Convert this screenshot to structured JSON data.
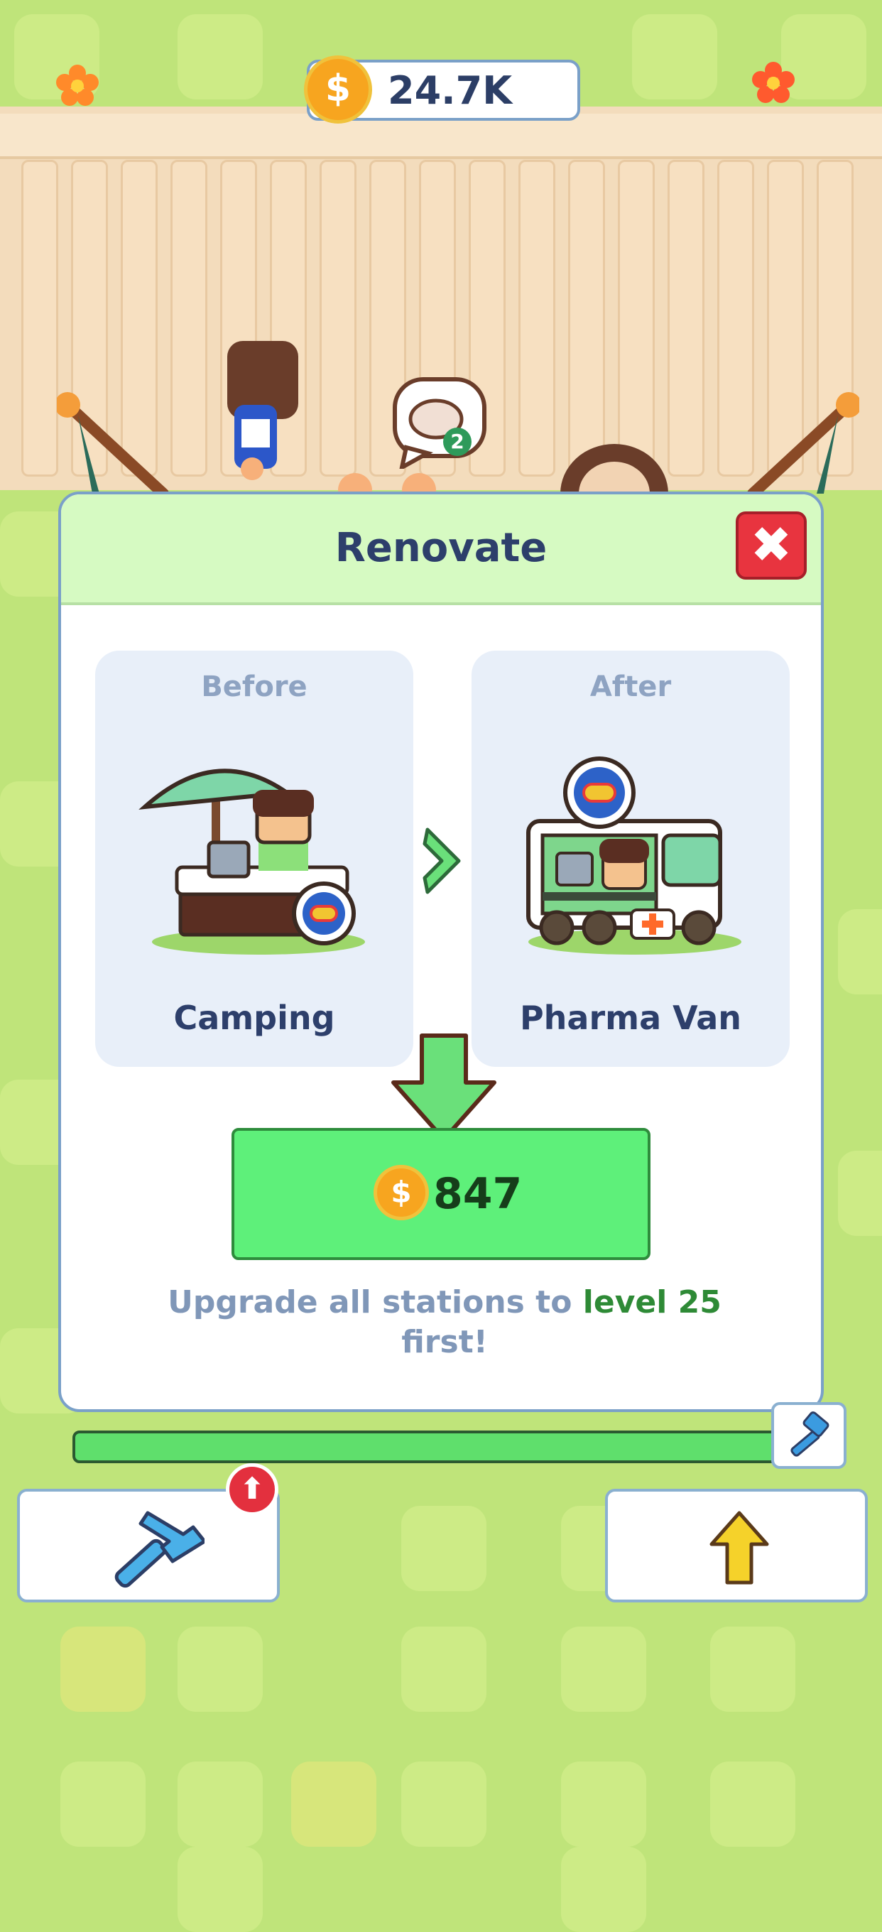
{
  "hud": {
    "coins": "24.7K",
    "coin_symbol": "$"
  },
  "bubble": {
    "count": "2"
  },
  "modal": {
    "title": "Renovate",
    "close_label": "✖",
    "before": {
      "label": "Before",
      "name": "Camping"
    },
    "after": {
      "label": "After",
      "name": "Pharma Van"
    },
    "price": "847",
    "price_symbol": "$",
    "requirement_prefix": "Upgrade all stations to",
    "requirement_level": "level 25",
    "requirement_suffix": "first!"
  },
  "progress": {
    "fill_fraction": 1.0
  },
  "bottom_bar": {
    "left_badge": "⬆"
  },
  "colors": {
    "ground": "#bfe47a",
    "modal_header": "#d6fac2",
    "buy_button": "#5ef07a",
    "close_button": "#e8343f",
    "coin": "#f7a51f",
    "accent_text": "#2d3f6b",
    "requirement_highlight": "#2e8a36"
  }
}
